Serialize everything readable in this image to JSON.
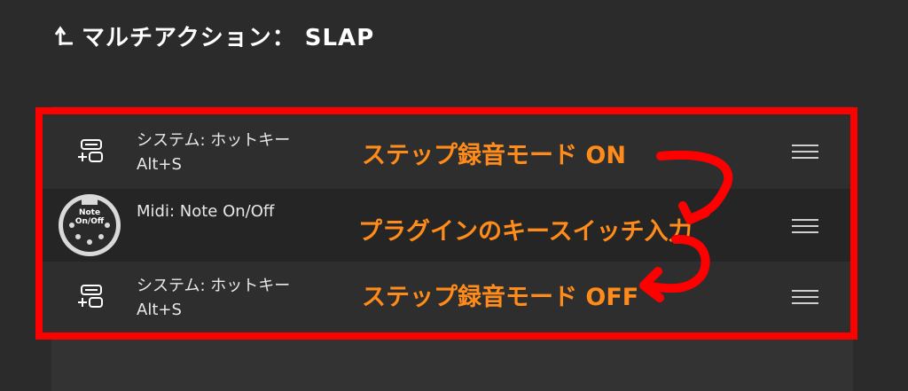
{
  "header": {
    "title": "マルチアクション： SLAP"
  },
  "actions": [
    {
      "line1": "システム: ホットキー",
      "line2": "Alt+S",
      "annotation": "ステップ録音モード ON"
    },
    {
      "line1": "Midi: Note On/Off",
      "line2": "",
      "annotation": "プラグインのキースイッチ入力",
      "icon_label_top": "Note",
      "icon_label_bottom": "On/Off"
    },
    {
      "line1": "システム: ホットキー",
      "line2": "Alt+S",
      "annotation": "ステップ録音モード OFF"
    }
  ],
  "colors": {
    "highlight_border": "#ff0000",
    "annotation_text": "#ff8c1a",
    "background": "#2b2b2b"
  },
  "icons": {
    "back": "back-arrow-icon",
    "hotkey": "hotkey-icon",
    "midi": "midi-note-icon",
    "drag": "drag-handle-icon"
  }
}
